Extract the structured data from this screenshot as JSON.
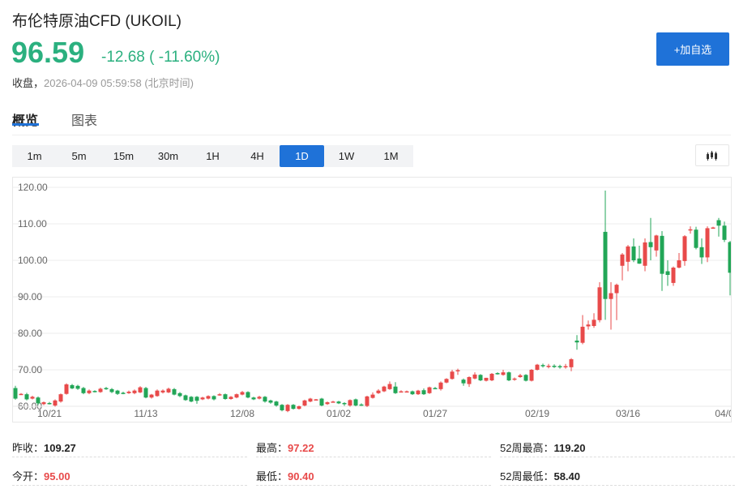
{
  "header": {
    "title": "布伦特原油CFD  (UKOIL)",
    "price": "96.59",
    "change": "-12.68 ( -11.60%)",
    "status_label": "收盘，",
    "timestamp": "2026-04-09 05:59:58  (北京时间)",
    "add_button": "+加自选"
  },
  "tabs": [
    {
      "label": "概览"
    },
    {
      "label": "图表"
    }
  ],
  "periods": [
    "1m",
    "5m",
    "15m",
    "30m",
    "1H",
    "4H",
    "1D",
    "1W",
    "1M"
  ],
  "active_period": "1D",
  "colors": {
    "up": "#e84a4a",
    "down": "#22a657",
    "accent": "#1f72d8",
    "price": "#2bb07f"
  },
  "stats": [
    {
      "label": "昨收：",
      "value": "109.27",
      "red": false
    },
    {
      "label": "最高：",
      "value": "97.22",
      "red": true
    },
    {
      "label": "52周最高：",
      "value": "119.20",
      "red": false
    },
    {
      "label": "今开：",
      "value": "95.00",
      "red": true
    },
    {
      "label": "最低：",
      "value": "90.40",
      "red": true
    },
    {
      "label": "52周最低：",
      "value": "58.40",
      "red": false
    }
  ],
  "chart_data": {
    "type": "candlestick",
    "ylim": [
      58,
      122
    ],
    "yticks": [
      "60.00",
      "70.00",
      "80.00",
      "90.00",
      "100.00",
      "110.00",
      "120.00"
    ],
    "ytick_values": [
      60,
      70,
      80,
      90,
      100,
      110,
      120
    ],
    "xlabels": [
      {
        "label": "10/21",
        "index": 6
      },
      {
        "label": "11/13",
        "index": 23
      },
      {
        "label": "12/08",
        "index": 40
      },
      {
        "label": "01/02",
        "index": 57
      },
      {
        "label": "01/27",
        "index": 74
      },
      {
        "label": "02/19",
        "index": 92
      },
      {
        "label": "03/16",
        "index": 108
      },
      {
        "label": "04/0",
        "index": 125
      }
    ],
    "ohlc": [
      [
        65,
        65.6,
        61.8,
        62.1
      ],
      [
        63.3,
        63.6,
        63.1,
        63.4
      ],
      [
        63.3,
        63.7,
        61.6,
        61.9
      ],
      [
        62.1,
        62.9,
        61.9,
        62.6
      ],
      [
        62.4,
        62.7,
        60.3,
        60.8
      ],
      [
        60.6,
        61.3,
        60.3,
        61.1
      ],
      [
        60.9,
        61.2,
        60.5,
        60.8
      ],
      [
        60.2,
        61.9,
        59.9,
        61.6
      ],
      [
        61.3,
        63.5,
        61,
        63.3
      ],
      [
        63.4,
        66.3,
        63.2,
        66
      ],
      [
        65.8,
        66.1,
        64.7,
        64.9
      ],
      [
        65.6,
        65.9,
        64.5,
        64.8
      ],
      [
        65,
        65.3,
        63.3,
        63.6
      ],
      [
        63.6,
        64.6,
        63.3,
        64.3
      ],
      [
        64.2,
        64.4,
        63.8,
        64.1
      ],
      [
        63.9,
        65.1,
        63.7,
        64.8
      ],
      [
        65,
        65.3,
        64.5,
        64.7
      ],
      [
        64.7,
        65,
        63.6,
        63.9
      ],
      [
        64.3,
        64.5,
        63.1,
        63.4
      ],
      [
        63.7,
        64,
        63.3,
        63.6
      ],
      [
        63.6,
        64.3,
        63.4,
        64
      ],
      [
        63.6,
        64.6,
        63.3,
        64.3
      ],
      [
        63.8,
        65.5,
        63.6,
        65.2
      ],
      [
        65,
        65.3,
        62.2,
        62.4
      ],
      [
        62.4,
        63.4,
        62.1,
        63.2
      ],
      [
        62.8,
        64.6,
        62.6,
        64.3
      ],
      [
        63.8,
        64.6,
        63.5,
        64.3
      ],
      [
        63.8,
        65.1,
        63.6,
        64.8
      ],
      [
        64.7,
        65,
        63,
        63.2
      ],
      [
        63.6,
        63.9,
        62.5,
        62.8
      ],
      [
        63,
        63.2,
        61.5,
        61.7
      ],
      [
        62.6,
        62.8,
        61.1,
        61.3
      ],
      [
        62.6,
        62.8,
        60.7,
        61.5
      ],
      [
        61.9,
        62.6,
        61.7,
        62.4
      ],
      [
        62.1,
        63,
        61.9,
        62.8
      ],
      [
        62.8,
        63,
        61.6,
        61.9
      ],
      [
        63.2,
        63.6,
        62.9,
        63.3
      ],
      [
        63.3,
        63.5,
        61.8,
        62
      ],
      [
        62,
        62.8,
        61.8,
        62.6
      ],
      [
        62.4,
        63.5,
        62.2,
        63.3
      ],
      [
        63.2,
        64.2,
        63,
        63.9
      ],
      [
        63.9,
        64.1,
        62.2,
        62.4
      ],
      [
        62.4,
        62.6,
        61.7,
        61.9
      ],
      [
        62.1,
        62.9,
        61.9,
        62.6
      ],
      [
        62.6,
        62.8,
        61,
        61.3
      ],
      [
        61.6,
        61.8,
        60.7,
        61
      ],
      [
        61.3,
        61.5,
        59.9,
        60.2
      ],
      [
        60.4,
        60.6,
        58.6,
        58.9
      ],
      [
        58.7,
        60.6,
        58.4,
        60.4
      ],
      [
        60.4,
        60.6,
        59.1,
        59.3
      ],
      [
        59.3,
        60.2,
        59.1,
        60
      ],
      [
        60.2,
        61.8,
        60,
        61.6
      ],
      [
        61.3,
        62.3,
        61.1,
        62.1
      ],
      [
        61.8,
        62,
        61.7,
        61.9
      ],
      [
        62.1,
        62.3,
        60,
        60.2
      ],
      [
        60.6,
        61.3,
        60.4,
        61.1
      ],
      [
        61.2,
        61.5,
        61,
        61.3
      ],
      [
        61.3,
        61.5,
        60.6,
        60.8
      ],
      [
        60.9,
        61.1,
        60.1,
        60.8
      ],
      [
        60.2,
        61.9,
        59.9,
        61.7
      ],
      [
        61.9,
        62.1,
        60,
        60.2
      ],
      [
        60.5,
        60.8,
        60.1,
        60.4
      ],
      [
        60.1,
        62.9,
        59.8,
        62.7
      ],
      [
        62.3,
        63.8,
        62.1,
        63.2
      ],
      [
        63.6,
        64.7,
        63.4,
        64.3
      ],
      [
        64.1,
        65.6,
        63.9,
        65.4
      ],
      [
        64.7,
        66.8,
        64.5,
        66.1
      ],
      [
        65.4,
        66.6,
        63.4,
        63.6
      ],
      [
        64,
        64.4,
        63.8,
        64.1
      ],
      [
        64,
        64.3,
        63.8,
        64.1
      ],
      [
        64.1,
        64.3,
        63.1,
        63.3
      ],
      [
        63.3,
        64.5,
        63.1,
        64.3
      ],
      [
        64.4,
        64.9,
        63.1,
        63.3
      ],
      [
        63.6,
        65.4,
        63.4,
        65.2
      ],
      [
        65,
        65.3,
        64.7,
        64.9
      ],
      [
        64.7,
        66.8,
        64.3,
        66.5
      ],
      [
        66.5,
        67.7,
        66.3,
        67.5
      ],
      [
        67.5,
        70,
        67.3,
        69.5
      ],
      [
        69.8,
        70.3,
        68.6,
        69.9
      ],
      [
        67.3,
        67.6,
        65.6,
        66.3
      ],
      [
        66.1,
        68.2,
        65.3,
        68
      ],
      [
        67.6,
        69.3,
        67.4,
        68.7
      ],
      [
        68.6,
        68.8,
        66.9,
        67.1
      ],
      [
        67,
        67.8,
        66.8,
        67.8
      ],
      [
        67.1,
        69.1,
        66.9,
        68.9
      ],
      [
        69.1,
        69.3,
        68.7,
        68.9
      ],
      [
        68.6,
        70,
        68.4,
        69.3
      ],
      [
        69.3,
        69.5,
        66.9,
        67.1
      ],
      [
        67.4,
        67.9,
        67,
        67.6
      ],
      [
        68,
        68.9,
        67.8,
        68.5
      ],
      [
        68.6,
        68.8,
        66.8,
        67
      ],
      [
        67,
        70.2,
        66.8,
        70
      ],
      [
        70,
        71.6,
        69.8,
        71.4
      ],
      [
        71.3,
        71.7,
        70.6,
        71.1
      ],
      [
        70.9,
        71.6,
        70.4,
        71.1
      ],
      [
        71.1,
        71.5,
        70.5,
        70.9
      ],
      [
        71,
        71.4,
        70.3,
        70.8
      ],
      [
        70.8,
        71.6,
        70.3,
        71
      ],
      [
        70.7,
        73.2,
        69.6,
        72.9
      ],
      [
        78,
        79.5,
        75.5,
        77.5
      ],
      [
        77.4,
        85,
        77,
        81.8
      ],
      [
        81.9,
        83.5,
        81,
        82.4
      ],
      [
        82,
        85.5,
        81.5,
        83.7
      ],
      [
        83.6,
        94,
        83,
        92.6
      ],
      [
        107.8,
        119.1,
        83.7,
        89.4
      ],
      [
        89.4,
        94,
        81,
        91
      ],
      [
        91,
        93.6,
        83.6,
        93.3
      ],
      [
        98.5,
        102,
        94.5,
        101.6
      ],
      [
        99.6,
        104.2,
        97,
        103.8
      ],
      [
        103.8,
        106,
        99.5,
        100
      ],
      [
        100.5,
        104,
        99,
        99.1
      ],
      [
        98.5,
        106,
        97,
        104.9
      ],
      [
        105,
        111.6,
        100,
        103.6
      ],
      [
        102.7,
        107,
        101,
        106.8
      ],
      [
        106.7,
        108,
        91.6,
        96.3
      ],
      [
        97,
        100,
        93,
        96
      ],
      [
        93.8,
        98.3,
        93,
        98
      ],
      [
        98,
        102,
        97.8,
        100
      ],
      [
        99.8,
        106.9,
        98.5,
        106.6
      ],
      [
        108.4,
        109.3,
        107.3,
        108.5
      ],
      [
        108.4,
        109.2,
        103,
        103.4
      ],
      [
        103.6,
        106,
        99,
        100.8
      ],
      [
        100.8,
        109.3,
        99.5,
        108.8
      ],
      [
        108.8,
        109.2,
        108.7,
        109
      ],
      [
        111,
        111.6,
        106.5,
        109.5
      ],
      [
        109.5,
        110.6,
        105,
        105.6
      ],
      [
        105,
        105.3,
        90.4,
        96.59
      ]
    ]
  }
}
